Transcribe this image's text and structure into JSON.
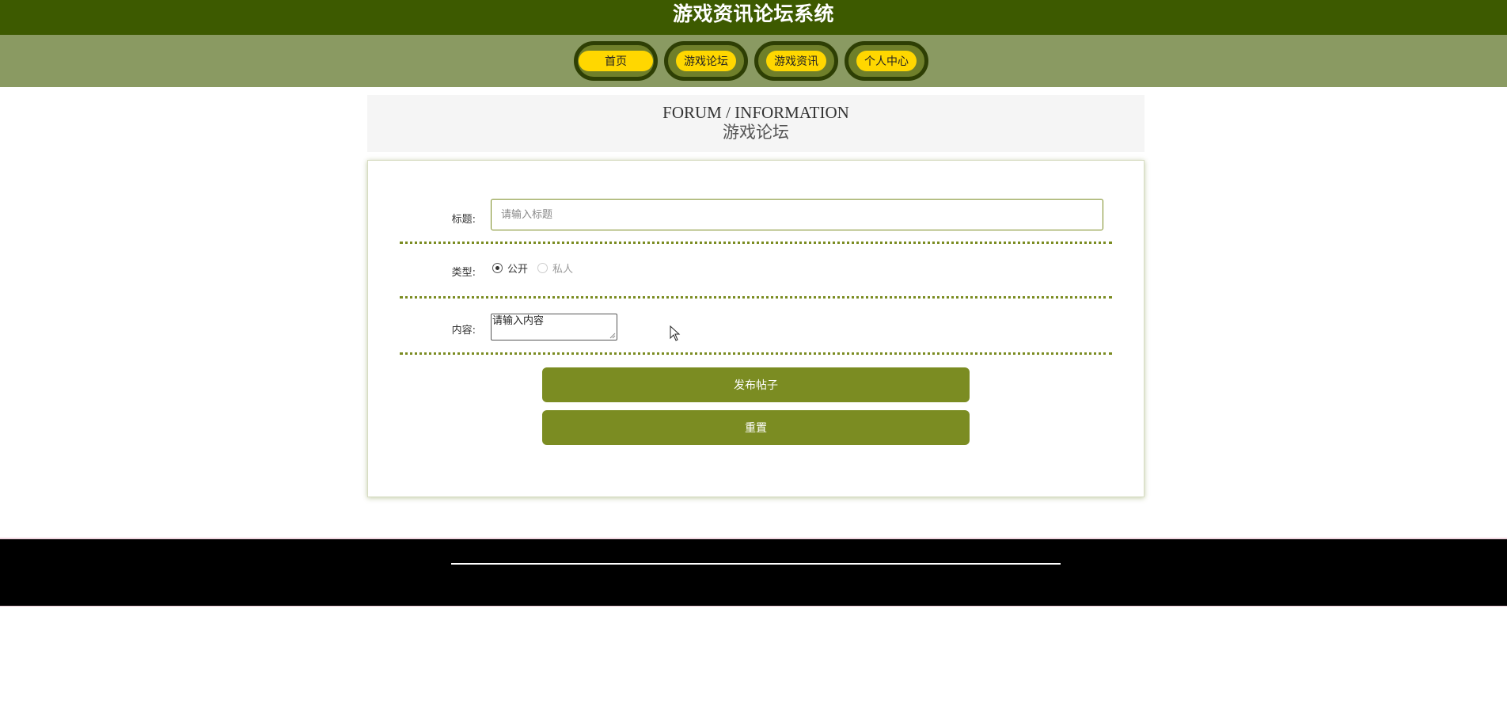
{
  "header": {
    "site_title": "游戏资讯论坛系统"
  },
  "nav": {
    "items": [
      {
        "label": "首页"
      },
      {
        "label": "游戏论坛"
      },
      {
        "label": "游戏资讯"
      },
      {
        "label": "个人中心"
      }
    ]
  },
  "section": {
    "title_en": "FORUM / INFORMATION",
    "title_cn": "游戏论坛"
  },
  "form": {
    "title_label": "标题:",
    "title_placeholder": "请输入标题",
    "type_label": "类型:",
    "type_options": [
      {
        "label": "公开",
        "selected": true
      },
      {
        "label": "私人",
        "selected": false
      }
    ],
    "content_label": "内容:",
    "content_placeholder": "请输入内容",
    "submit_label": "发布帖子",
    "reset_label": "重置"
  },
  "colors": {
    "topbar": "#3d5a00",
    "navbar": "#8a9a62",
    "accent": "#7b8c22",
    "pill_fill": "#ffd700",
    "footer": "#000000"
  }
}
